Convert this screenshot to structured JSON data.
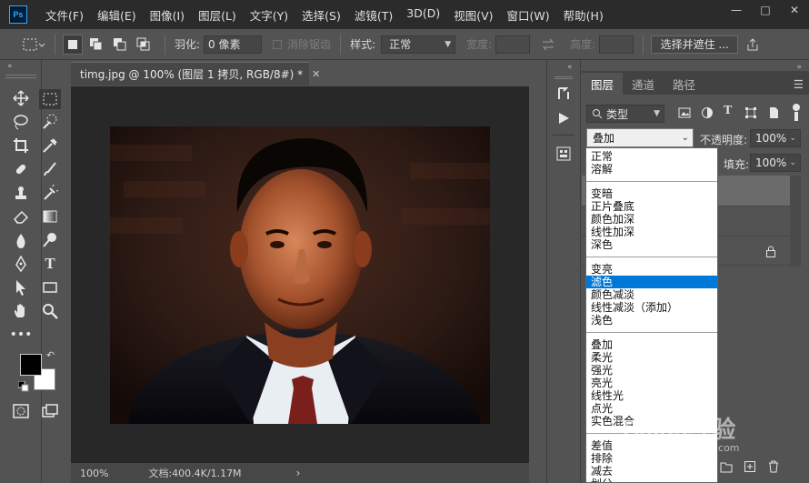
{
  "app": {
    "logo": "Ps"
  },
  "menu": [
    "文件(F)",
    "编辑(E)",
    "图像(I)",
    "图层(L)",
    "文字(Y)",
    "选择(S)",
    "滤镜(T)",
    "3D(D)",
    "视图(V)",
    "窗口(W)",
    "帮助(H)"
  ],
  "window_controls": {
    "minimize": "—",
    "maximize": "□",
    "close": "✕"
  },
  "options": {
    "feather_label": "羽化:",
    "feather_value": "0 像素",
    "antialias_label": "消除锯齿",
    "style_label": "样式:",
    "style_value": "正常",
    "width_label": "宽度:",
    "height_label": "高度:",
    "select_mask_button": "选择并遮住 ..."
  },
  "document": {
    "tab_title": "timg.jpg @ 100% (图层 1 拷贝, RGB/8#) *",
    "close": "✕",
    "zoom": "100%",
    "doc_info": "文档:400.4K/1.17M",
    "status_arrow": "›"
  },
  "layers_panel": {
    "tabs": [
      "图层",
      "通道",
      "路径"
    ],
    "active_tab": "图层",
    "filter_kind": "类型",
    "blend_mode": "叠加",
    "opacity_label": "不透明度:",
    "opacity_value": "100%",
    "fill_label": "填充:",
    "fill_value": "100%"
  },
  "blend_groups": [
    [
      "正常",
      "溶解"
    ],
    [
      "变暗",
      "正片叠底",
      "颜色加深",
      "线性加深",
      "深色"
    ],
    [
      "变亮",
      "滤色",
      "颜色减淡",
      "线性减淡（添加）",
      "浅色"
    ],
    [
      "叠加",
      "柔光",
      "强光",
      "亮光",
      "线性光",
      "点光",
      "实色混合"
    ],
    [
      "差值",
      "排除",
      "减去",
      "划分"
    ]
  ],
  "selected_blend_option": "滤色",
  "colors": {
    "accent": "#0078d7",
    "foreground_swatch": "#000000",
    "background_swatch": "#ffffff",
    "ps_blue": "#31a8ff"
  },
  "watermark": {
    "brand": "Baidu经验",
    "url": "jingyan.baidu.com"
  }
}
